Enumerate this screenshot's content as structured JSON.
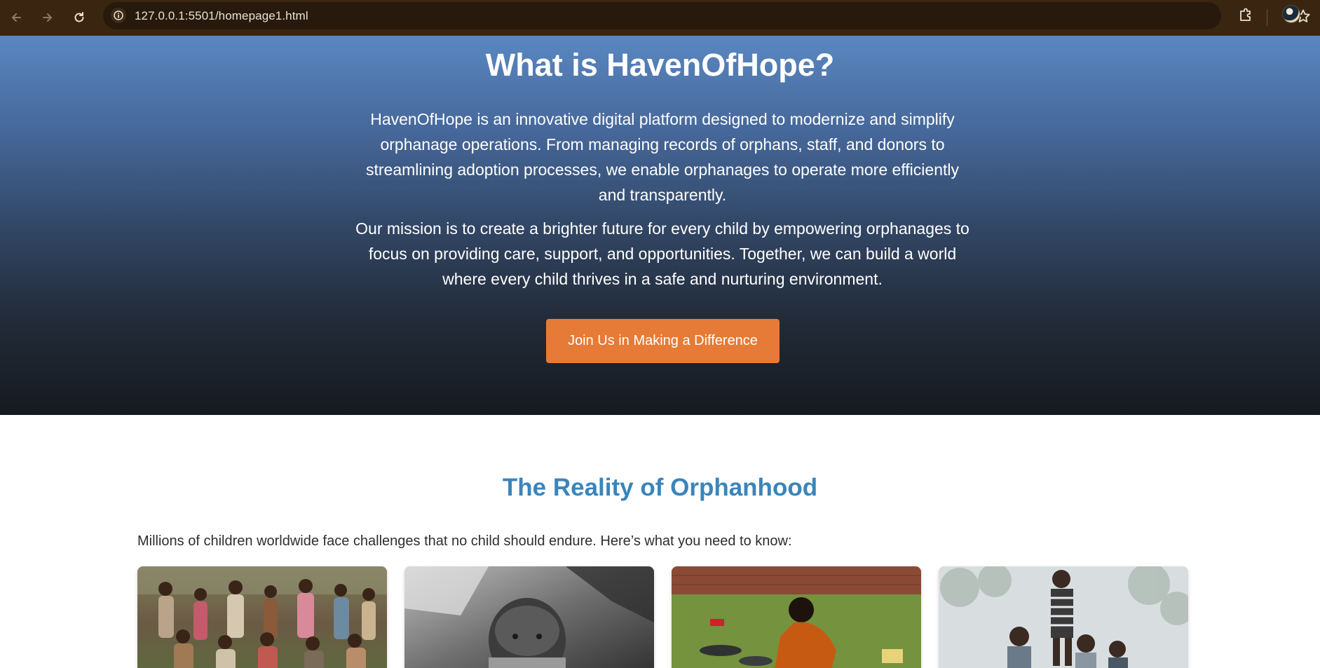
{
  "browser": {
    "url": "127.0.0.1:5501/homepage1.html",
    "icons": [
      "back-arrow-icon",
      "forward-arrow-icon",
      "reload-icon",
      "site-info-icon",
      "star-icon",
      "extensions-icon",
      "profile-avatar"
    ]
  },
  "hero": {
    "title": "What is HavenOfHope?",
    "paragraph1": "HavenOfHope is an innovative digital platform designed to modernize and simplify orphanage operations. From managing records of orphans, staff, and donors to streamlining adoption processes, we enable orphanages to operate more efficiently and transparently.",
    "paragraph2": "Our mission is to create a brighter future for every child by empowering orphanages to focus on providing care, support, and opportunities. Together, we can build a world where every child thrives in a safe and nurturing environment.",
    "cta_label": "Join Us in Making a Difference"
  },
  "reality": {
    "title": "The Reality of Orphanhood",
    "intro": "Millions of children worldwide face challenges that no child should endure. Here’s what you need to know:"
  },
  "colors": {
    "accent_orange": "#e57b36",
    "section_title_blue": "#3a85bb",
    "hero_top": "#5a87c1",
    "hero_bottom": "#161a20"
  }
}
